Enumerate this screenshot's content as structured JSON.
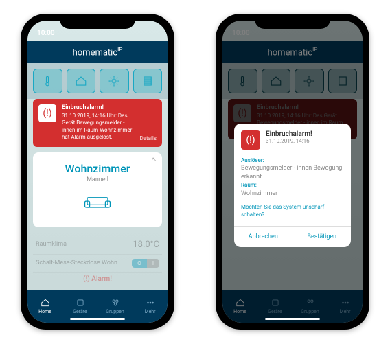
{
  "status": {
    "time": "10:00"
  },
  "brand": "homematic",
  "brand_suffix": "IP",
  "tiles": [
    {
      "name": "thermometer-icon"
    },
    {
      "name": "house-icon"
    },
    {
      "name": "sun-icon"
    },
    {
      "name": "blinds-icon"
    }
  ],
  "alarm_banner": {
    "title": "Einbruchalarm!",
    "body": "31.10.2019, 14:16 Uhr: Das Gerät Bewegungsmelder - innen im Raum Wohnzimmer hat Alarm ausgelöst.",
    "details": "Details"
  },
  "room_card": {
    "name": "Wohnzimmer",
    "mode": "Manuell"
  },
  "bg_rows": {
    "row1_label": "Raumklima",
    "row1_value": "18.0°C",
    "row2_label": "Schalt-Mess-Steckdose Wohn…",
    "row2_on": "O",
    "row2_off": "I"
  },
  "alarm_strip": "(!) Alarm!",
  "nav": [
    {
      "label": "Home",
      "name": "nav-home"
    },
    {
      "label": "Geräte",
      "name": "nav-devices"
    },
    {
      "label": "Gruppen",
      "name": "nav-groups"
    },
    {
      "label": "Mehr",
      "name": "nav-more"
    }
  ],
  "modal": {
    "title": "Einbruchalarm!",
    "date": "31.10.2019, 14:16",
    "trigger_label": "Auslöser:",
    "trigger_value": "Bewegungsmelder - innen Bewegung erkannt",
    "room_label": "Raum:",
    "room_value": "Wohnzimmer",
    "question": "Möchten Sie das System unscharf schalten?",
    "cancel": "Abbrechen",
    "confirm": "Bestätigen"
  }
}
